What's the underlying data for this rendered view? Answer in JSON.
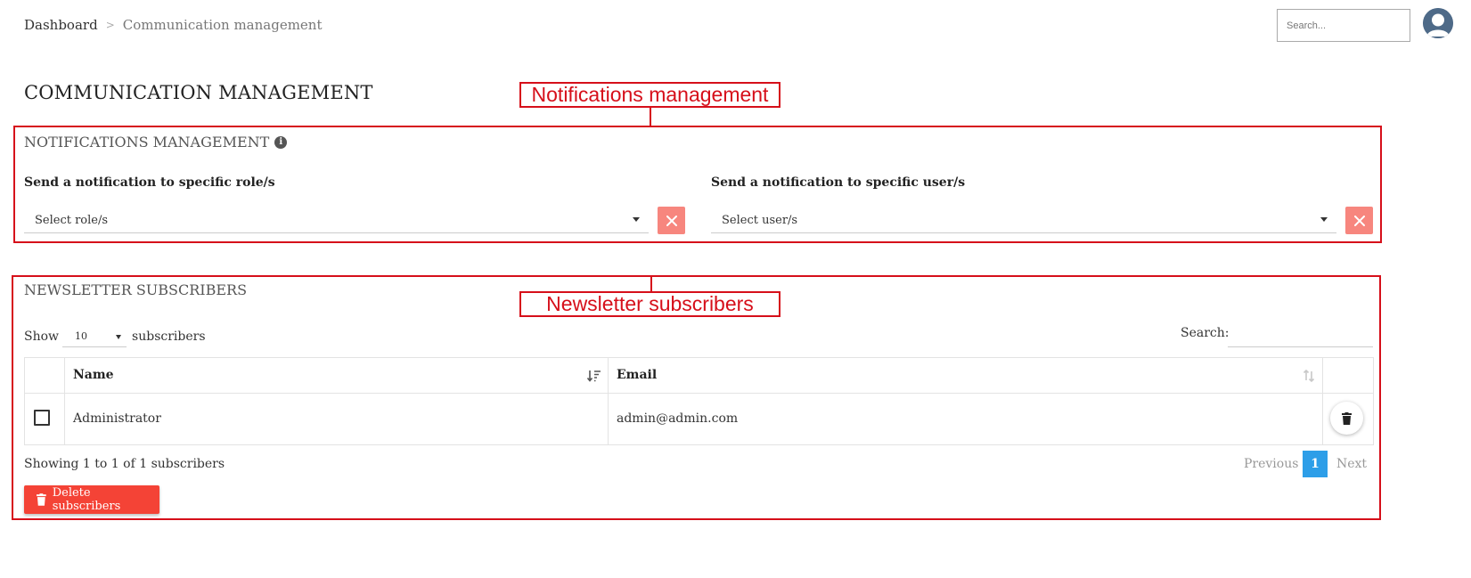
{
  "breadcrumb": {
    "home": "Dashboard",
    "separator": ">",
    "current": "Communication management"
  },
  "header": {
    "search_placeholder": "Search..."
  },
  "page": {
    "title": "COMMUNICATION MANAGEMENT"
  },
  "callouts": {
    "notifications": "Notifications management",
    "newsletter": "Newsletter subscribers"
  },
  "notifications": {
    "title": "NOTIFICATIONS MANAGEMENT",
    "info_icon": "i",
    "roles_label": "Send a notification to specific role/s",
    "roles_placeholder": "Select role/s",
    "users_label": "Send a notification to specific user/s",
    "users_placeholder": "Select user/s"
  },
  "newsletter": {
    "title": "NEWSLETTER SUBSCRIBERS",
    "show_label": "Show",
    "page_length": "10",
    "entries_label": "subscribers",
    "search_label": "Search:",
    "columns": {
      "name": "Name",
      "email": "Email"
    },
    "rows": [
      {
        "name": "Administrator",
        "email": "admin@admin.com"
      }
    ],
    "info": "Showing 1 to 1 of 1 subscribers",
    "pagination": {
      "previous": "Previous",
      "current": "1",
      "next": "Next"
    },
    "delete_button": "Delete subscribers"
  },
  "colors": {
    "accent_red": "#d60f1a",
    "danger": "#f44336",
    "clear_button": "#f7867e",
    "pager_active": "#2d9ee8"
  }
}
